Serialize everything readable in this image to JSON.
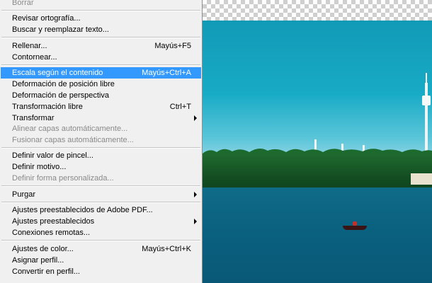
{
  "menu": {
    "items": [
      {
        "label": "Borrar",
        "shortcut": "",
        "disabled": true
      },
      {
        "label": "Revisar ortografía...",
        "shortcut": ""
      },
      {
        "label": "Buscar y reemplazar texto...",
        "shortcut": ""
      },
      {
        "label": "Rellenar...",
        "shortcut": "Mayús+F5"
      },
      {
        "label": "Contornear...",
        "shortcut": ""
      },
      {
        "label": "Escala según el contenido",
        "shortcut": "Mayús+Ctrl+A",
        "selected": true
      },
      {
        "label": "Deformación de posición libre",
        "shortcut": ""
      },
      {
        "label": "Deformación de perspectiva",
        "shortcut": ""
      },
      {
        "label": "Transformación libre",
        "shortcut": "Ctrl+T"
      },
      {
        "label": "Transformar",
        "shortcut": "",
        "submenu": true
      },
      {
        "label": "Alinear capas automáticamente...",
        "shortcut": "",
        "disabled": true
      },
      {
        "label": "Fusionar capas automáticamente...",
        "shortcut": "",
        "disabled": true
      },
      {
        "label": "Definir valor de pincel...",
        "shortcut": ""
      },
      {
        "label": "Definir motivo...",
        "shortcut": ""
      },
      {
        "label": "Definir forma personalizada...",
        "shortcut": "",
        "disabled": true
      },
      {
        "label": "Purgar",
        "shortcut": "",
        "submenu": true
      },
      {
        "label": "Ajustes preestablecidos de Adobe PDF...",
        "shortcut": ""
      },
      {
        "label": "Ajustes preestablecidos",
        "shortcut": "",
        "submenu": true
      },
      {
        "label": "Conexiones remotas...",
        "shortcut": ""
      },
      {
        "label": "Ajustes de color...",
        "shortcut": "Mayús+Ctrl+K"
      },
      {
        "label": "Asignar perfil...",
        "shortcut": ""
      },
      {
        "label": "Convertir en perfil...",
        "shortcut": ""
      }
    ]
  },
  "colors": {
    "selection_highlight": "#3399ff",
    "menu_background": "#f0f0f0",
    "disabled_text": "#8a8a8a"
  }
}
